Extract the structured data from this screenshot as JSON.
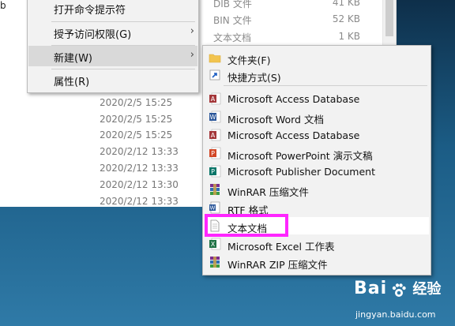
{
  "explorer": {
    "edge_char": "b",
    "dates": [
      "2020/2/5 15:25",
      "2020/2/5 15:25",
      "2020/2/5 15:25",
      "2020/2/12 13:33",
      "2020/2/12 13:33",
      "2020/2/12 13:30",
      "2020/2/12 13:33"
    ],
    "files": [
      {
        "type": "DIB 文件",
        "size": "41 KB"
      },
      {
        "type": "BIN 文件",
        "size": "52 KB"
      },
      {
        "type": "文本文档",
        "size": "1 KB"
      }
    ]
  },
  "context_menu": {
    "items": [
      {
        "label": "打开命令提示符"
      },
      {
        "label": "授予访问权限(G)",
        "arrow": "›"
      },
      {
        "label": "新建(W)",
        "arrow": "›"
      },
      {
        "label": "属性(R)"
      }
    ]
  },
  "new_submenu": {
    "items": [
      {
        "label": "文件夹(F)",
        "icon": "folder-icon"
      },
      {
        "label": "快捷方式(S)",
        "icon": "shortcut-icon"
      },
      {
        "label": "Microsoft Access Database",
        "icon": "access-icon"
      },
      {
        "label": "Microsoft Word 文档",
        "icon": "word-icon"
      },
      {
        "label": "Microsoft Access Database",
        "icon": "access-icon"
      },
      {
        "label": "Microsoft PowerPoint 演示文稿",
        "icon": "powerpoint-icon"
      },
      {
        "label": "Microsoft Publisher Document",
        "icon": "publisher-icon"
      },
      {
        "label": "WinRAR 压缩文件",
        "icon": "winrar-icon"
      },
      {
        "label": "RTF 格式",
        "icon": "rtf-icon"
      },
      {
        "label": "文本文档",
        "icon": "text-document-icon"
      },
      {
        "label": "Microsoft Excel 工作表",
        "icon": "excel-icon"
      },
      {
        "label": "WinRAR ZIP 压缩文件",
        "icon": "winrar-zip-icon"
      }
    ]
  },
  "watermark": {
    "main": "Bai",
    "cn": "经验",
    "url": "jingyan.baidu.com"
  },
  "colors": {
    "highlight": "#ff26ff",
    "menu_bg": "#f2f2f2",
    "desktop": "#1f5f86"
  }
}
